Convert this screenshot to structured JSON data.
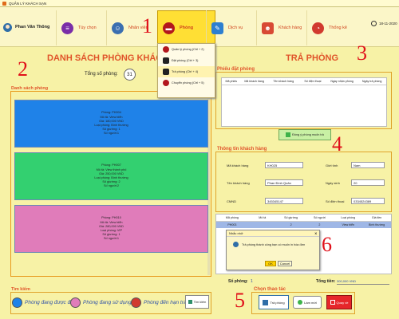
{
  "window": {
    "title": "QUẢN LÝ KHÁCH SẠN"
  },
  "user": {
    "name": "Phan Văn Thông"
  },
  "tabs": [
    {
      "label": "Tùy chọn",
      "color": "#7a2ea8"
    },
    {
      "label": "Nhân viên",
      "color": "#3b6fb0"
    },
    {
      "label": "Phòng",
      "color": "#b3171c"
    },
    {
      "label": "Dịch vụ",
      "color": "#2d7fd0"
    },
    {
      "label": "Khách hàng",
      "color": "#d84a34"
    },
    {
      "label": "Thống kê",
      "color": "#d13a2f"
    }
  ],
  "date": "18-11-2020",
  "markers": {
    "m1": "1",
    "m2": "2",
    "m3": "3",
    "m4": "4",
    "m5": "5",
    "m6": "6"
  },
  "dropdown": {
    "items": [
      {
        "label": "Quản lý phòng (Ctrl + 2)",
        "color": "#b3171c"
      },
      {
        "label": "Đặt phòng (Ctrl + 3)",
        "color": "#222"
      },
      {
        "label": "Trả phòng (Ctrl + 4)",
        "color": "#222"
      },
      {
        "label": "Chuyển phòng (Ctrl + 5)",
        "color": "#b3171c"
      }
    ]
  },
  "left": {
    "title": "DANH SÁCH PHÒNG KHÁCH",
    "total_label": "Tổng số phòng:",
    "total_value": "31",
    "list_label": "Danh sách phòng",
    "rooms": [
      {
        "lines": [
          "Phòng: PH004",
          "Mô tả: View biển",
          "Giá: 180,000 VND",
          "Loại phòng: Bình thường",
          "Số giường: 1",
          "Số người:1"
        ],
        "color": "#1f82e8"
      },
      {
        "lines": [
          "Phòng: PH007",
          "Mô tả: View thành phố",
          "Giá: 250,000 VND",
          "Loại phòng: Bình thường",
          "Số giường: 2",
          "Số người:2"
        ],
        "color": "#33d070"
      },
      {
        "lines": [
          "Phòng: PH010",
          "Mô tả: View biển",
          "Giá: 280,000 VND",
          "Loại phòng: VIP",
          "Số giường: 1",
          "Số người:1"
        ],
        "color": "#e07cba"
      }
    ],
    "search_label": "Tìm kiếm",
    "legend": [
      {
        "label": "Phòng đang được đặt",
        "color": "#1f82e8"
      },
      {
        "label": "Phòng đang sử dụng",
        "color": "#e07cba"
      },
      {
        "label": "Phòng đến hạn trả",
        "color": "#d13a2f"
      }
    ],
    "search_button": "Tìm kiếm"
  },
  "right": {
    "title": "TRẢ PHÒNG",
    "phieu_label": "Phiếu đặt phòng",
    "phieu_columns": [
      "Mã phiếu",
      "Mã khách hàng",
      "Tên khách hàng",
      "Số điện thoại",
      "Ngày nhận phòng",
      "Ngày trả phòng"
    ],
    "agree_button": "Đồng ý phòng muốn trả",
    "info_label": "Thông tin khách hàng",
    "fields": {
      "ma_kh_label": "Mã khách hàng",
      "ma_kh_value": "KH025",
      "gioi_tinh_label": "Giới tính",
      "gioi_tinh_value": "Nam",
      "ten_kh_label": "Tên khách hàng",
      "ten_kh_value": "Phan Đình Quân",
      "ngay_sinh_label": "Ngày sinh",
      "ngay_sinh_value": "20",
      "cmnd_label": "CMND",
      "cmnd_value": "345345147",
      "sdt_label": "Số điện thoại",
      "sdt_value": "0334524389"
    },
    "room_columns": [
      "Mã phòng",
      "Mô tả",
      "Số giường",
      "Số người",
      "Loại phòng",
      "Giá tiền"
    ],
    "room_rows": [
      [
        "PH003",
        "",
        "2",
        "2",
        "View biển",
        "Bình thường"
      ]
    ],
    "so_phong_label": "Số phòng:",
    "so_phong_value": "1",
    "tong_tien_label": "Tổng tiền:",
    "tong_tien_value": "300,000 VND",
    "actions_label": "Chọn thao tác",
    "btn_tra": "Trả phòng",
    "btn_lammoi": "Làm mới",
    "btn_quayve": "Quay về"
  },
  "dialog": {
    "title": "Nhắc nhở",
    "close": "X",
    "message": "Trả phòng thành công bạn có muốn in hóa đơn",
    "ok": "OK",
    "cancel": "Cancel"
  }
}
